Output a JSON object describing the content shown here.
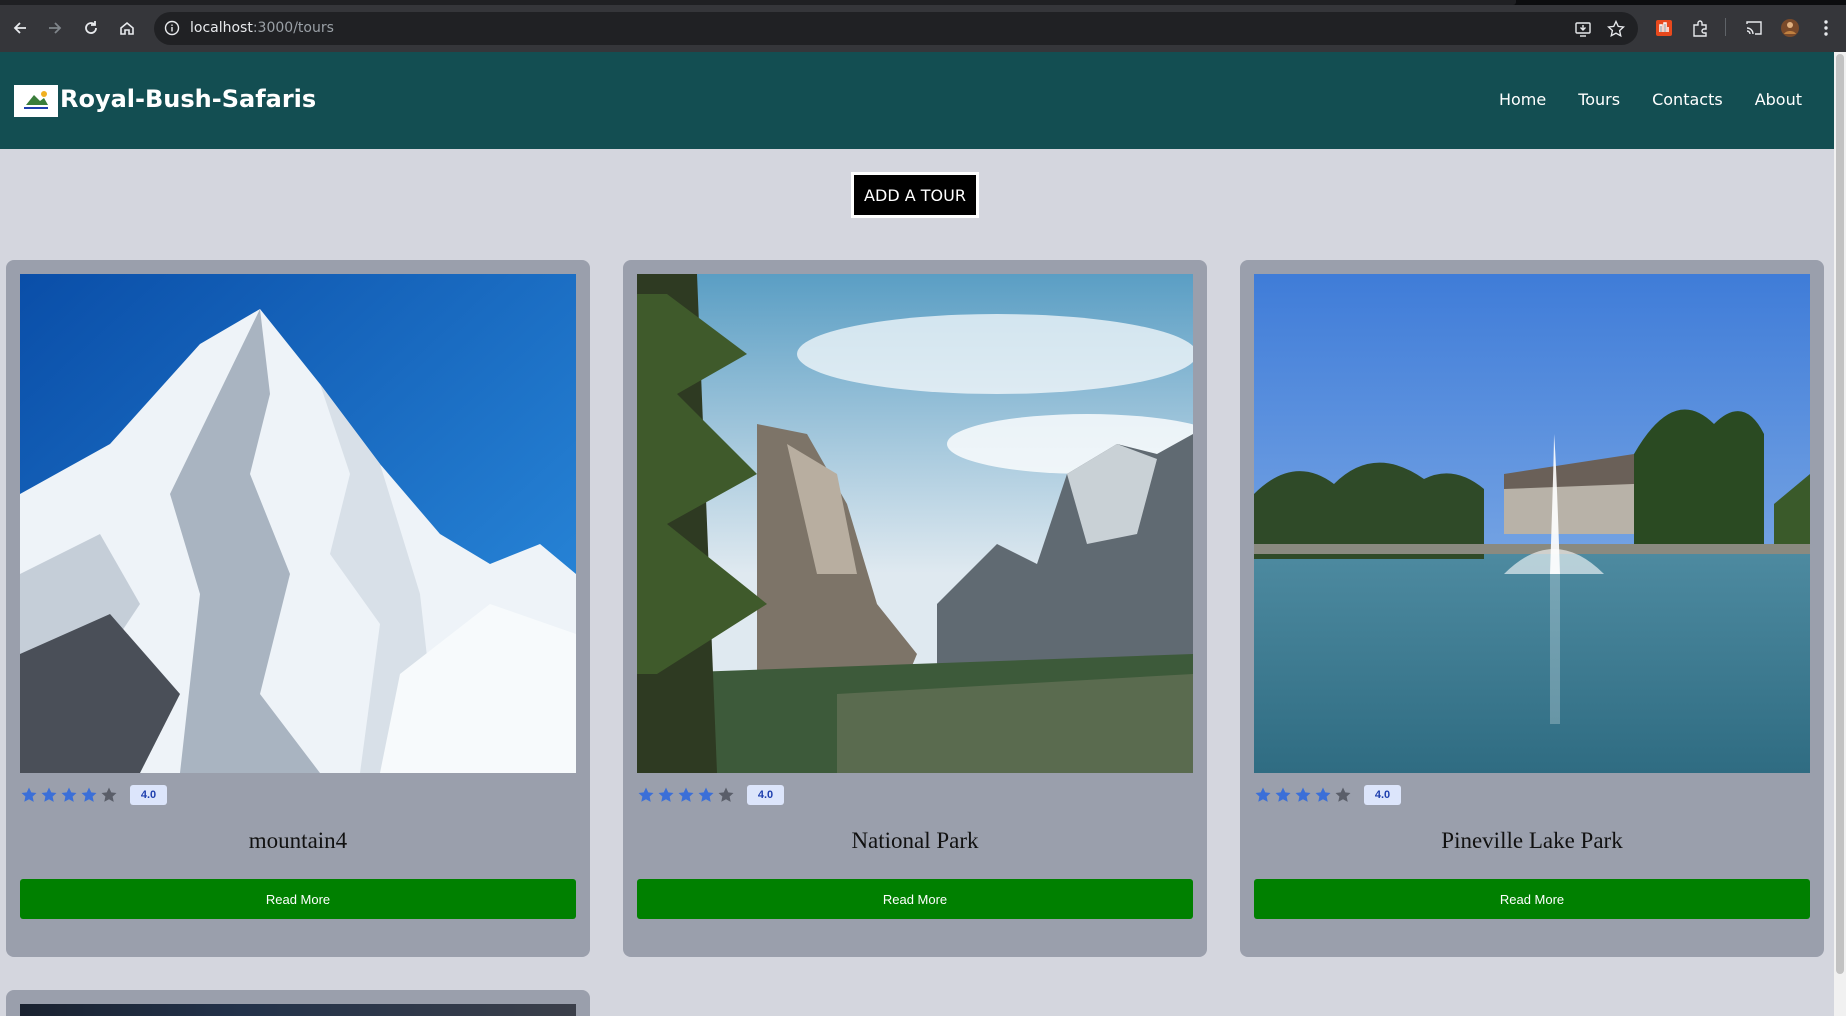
{
  "browser": {
    "url_host": "localhost",
    "url_path": ":3000/tours"
  },
  "navbar": {
    "brand": "Royal-Bush-Safaris",
    "links": [
      "Home",
      "Tours",
      "Contacts",
      "About"
    ]
  },
  "add_button": "ADD A TOUR",
  "tours": [
    {
      "title": "mountain4",
      "rating_value": 4,
      "rating_label": "4.0",
      "button": "Read More"
    },
    {
      "title": "National Park",
      "rating_value": 4,
      "rating_label": "4.0",
      "button": "Read More"
    },
    {
      "title": "Pineville Lake Park",
      "rating_value": 4,
      "rating_label": "4.0",
      "button": "Read More"
    }
  ],
  "colors": {
    "navbar": "#134e52",
    "page_bg": "#d4d6de",
    "card_bg": "#9a9fac",
    "button_green": "#008000",
    "star_filled": "#3b6fd8",
    "star_empty": "#5a5e69"
  }
}
